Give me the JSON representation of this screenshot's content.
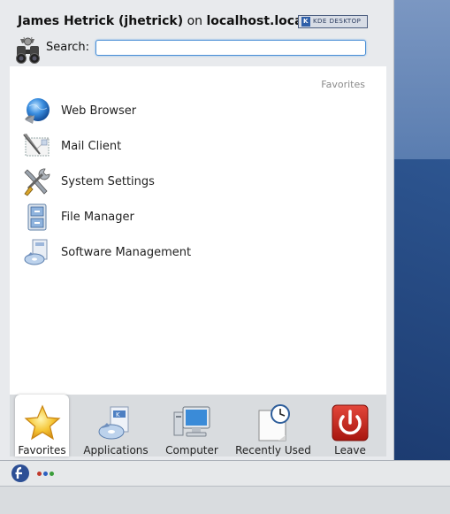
{
  "header": {
    "user_name": "James Hetrick (jhetrick)",
    "on_text": "on",
    "host": "localhost.locald",
    "badge_k": "K",
    "badge_text": "KDE DESKTOP"
  },
  "search": {
    "label": "Search:",
    "value": "",
    "placeholder": ""
  },
  "favorites": {
    "heading": "Favorites",
    "items": [
      {
        "label": "Web Browser",
        "icon": "globe-icon"
      },
      {
        "label": "Mail Client",
        "icon": "mail-icon"
      },
      {
        "label": "System Settings",
        "icon": "tools-icon"
      },
      {
        "label": "File Manager",
        "icon": "file-cabinet-icon"
      },
      {
        "label": "Software Management",
        "icon": "software-package-icon"
      }
    ]
  },
  "tabs": [
    {
      "label": "Favorites",
      "icon": "star-icon",
      "active": true
    },
    {
      "label": "Applications",
      "icon": "applications-icon",
      "active": false
    },
    {
      "label": "Computer",
      "icon": "computer-icon",
      "active": false
    },
    {
      "label": "Recently Used",
      "icon": "clock-document-icon",
      "active": false
    },
    {
      "label": "Leave",
      "icon": "power-icon",
      "active": false
    }
  ],
  "colors": {
    "accent": "#4a8fd6",
    "leave_red": "#c4231b",
    "panel_bg": "#ffffff",
    "chrome_bg": "#e8eaed"
  }
}
